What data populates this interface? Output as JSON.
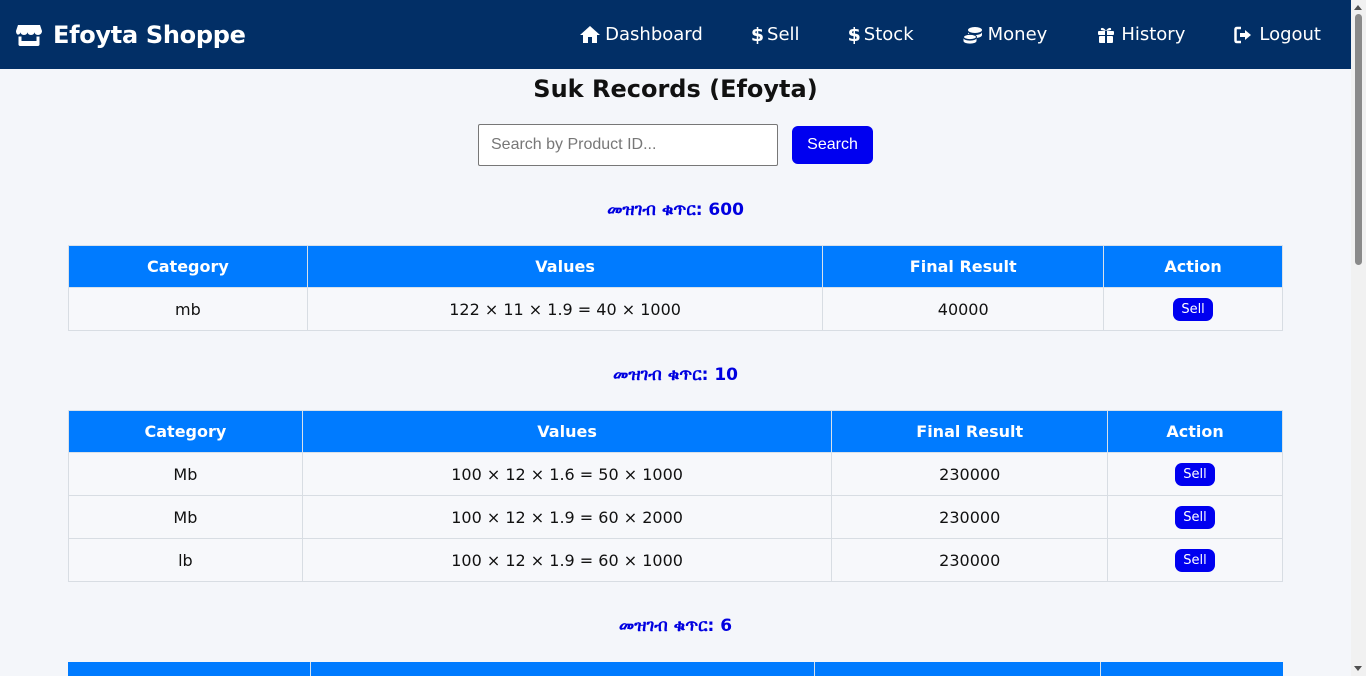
{
  "brand": {
    "name": "Efoyta Shoppe"
  },
  "nav": [
    {
      "label": "Dashboard",
      "icon": "home-icon"
    },
    {
      "label": "Sell",
      "icon": "dollar-icon"
    },
    {
      "label": "Stock",
      "icon": "dollar-icon"
    },
    {
      "label": "Money",
      "icon": "coins-icon"
    },
    {
      "label": "History",
      "icon": "gift-icon"
    },
    {
      "label": "Logout",
      "icon": "logout-icon"
    }
  ],
  "page": {
    "title": "Suk Records (Efoyta)"
  },
  "search": {
    "placeholder": "Search by Product ID...",
    "value": "",
    "button_label": "Search"
  },
  "table_headers": [
    "Category",
    "Values",
    "Final Result",
    "Action"
  ],
  "groups": [
    {
      "title": "መዝገብ ቁጥር: 600",
      "rows": [
        {
          "category": "mb",
          "values": "122 × 11 × 1.9 = 40 × 1000",
          "final": "40000",
          "action": "Sell"
        }
      ]
    },
    {
      "title": "መዝገብ ቁጥር: 10",
      "rows": [
        {
          "category": "Mb",
          "values": "100 × 12 × 1.6 = 50 × 1000",
          "final": "230000",
          "action": "Sell"
        },
        {
          "category": "Mb",
          "values": "100 × 12 × 1.9 = 60 × 2000",
          "final": "230000",
          "action": "Sell"
        },
        {
          "category": "lb",
          "values": "100 × 12 × 1.9 = 60 × 1000",
          "final": "230000",
          "action": "Sell"
        }
      ]
    },
    {
      "title": "መዝገብ ቁጥር: 6",
      "rows": []
    }
  ],
  "colors": {
    "navbar": "#022f66",
    "table_header": "#007bff",
    "button": "#0000f0",
    "group_title": "#0000e0"
  }
}
